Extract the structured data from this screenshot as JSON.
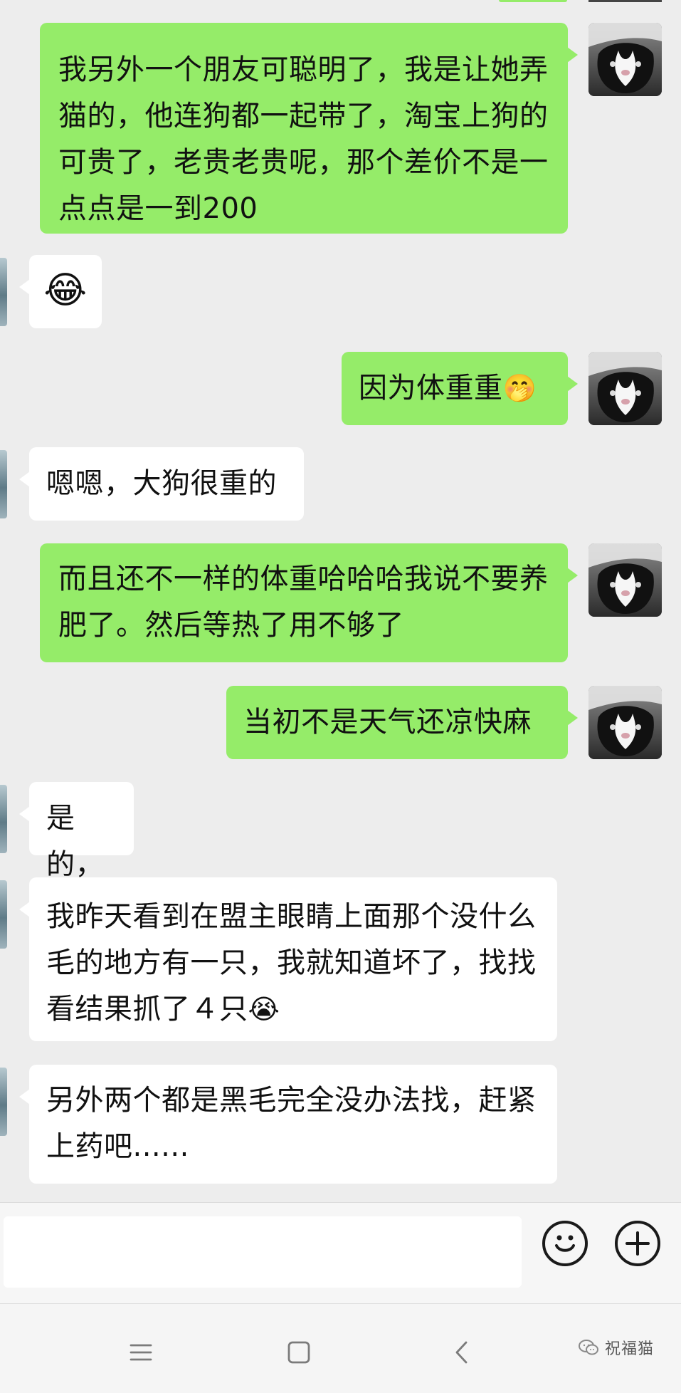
{
  "chat": {
    "messages": [
      {
        "side": "me",
        "text": "我另外一个朋友可聪明了，我是让她弄猫的，他连狗都一起带了，淘宝上狗的可贵了，老贵老贵呢，那个差价不是一点点是一到200"
      },
      {
        "side": "other",
        "emoji": "😂"
      },
      {
        "side": "me",
        "text": "因为体重重",
        "emoji": "🤭"
      },
      {
        "side": "other",
        "text": "嗯嗯，大狗很重的"
      },
      {
        "side": "me",
        "text": "而且还不一样的体重哈哈哈我说不要养肥了。然后等热了用不够了"
      },
      {
        "side": "me",
        "text": "当初不是天气还凉快麻"
      },
      {
        "side": "other",
        "text": "是的，"
      },
      {
        "side": "other",
        "text": "我昨天看到在盟主眼睛上面那个没什么毛的地方有一只，我就知道坏了，找找看结果抓了４只",
        "emoji": "😭"
      },
      {
        "side": "other",
        "text": "另外两个都是黑毛完全没办法找，赶紧上药吧......"
      }
    ]
  },
  "input_bar": {
    "value": "",
    "emoji_button_icon": "smiley-face-icon",
    "plus_button_icon": "plus-circle-icon"
  },
  "system_nav": {
    "menu_icon": "menu-lines-icon",
    "home_icon": "rounded-square-icon",
    "back_icon": "chevron-left-icon"
  },
  "watermark": {
    "text": "祝福猫",
    "icon": "wechat-icon"
  },
  "colors": {
    "chat_background": "#ededed",
    "my_bubble": "#95ec69",
    "their_bubble": "#ffffff"
  }
}
